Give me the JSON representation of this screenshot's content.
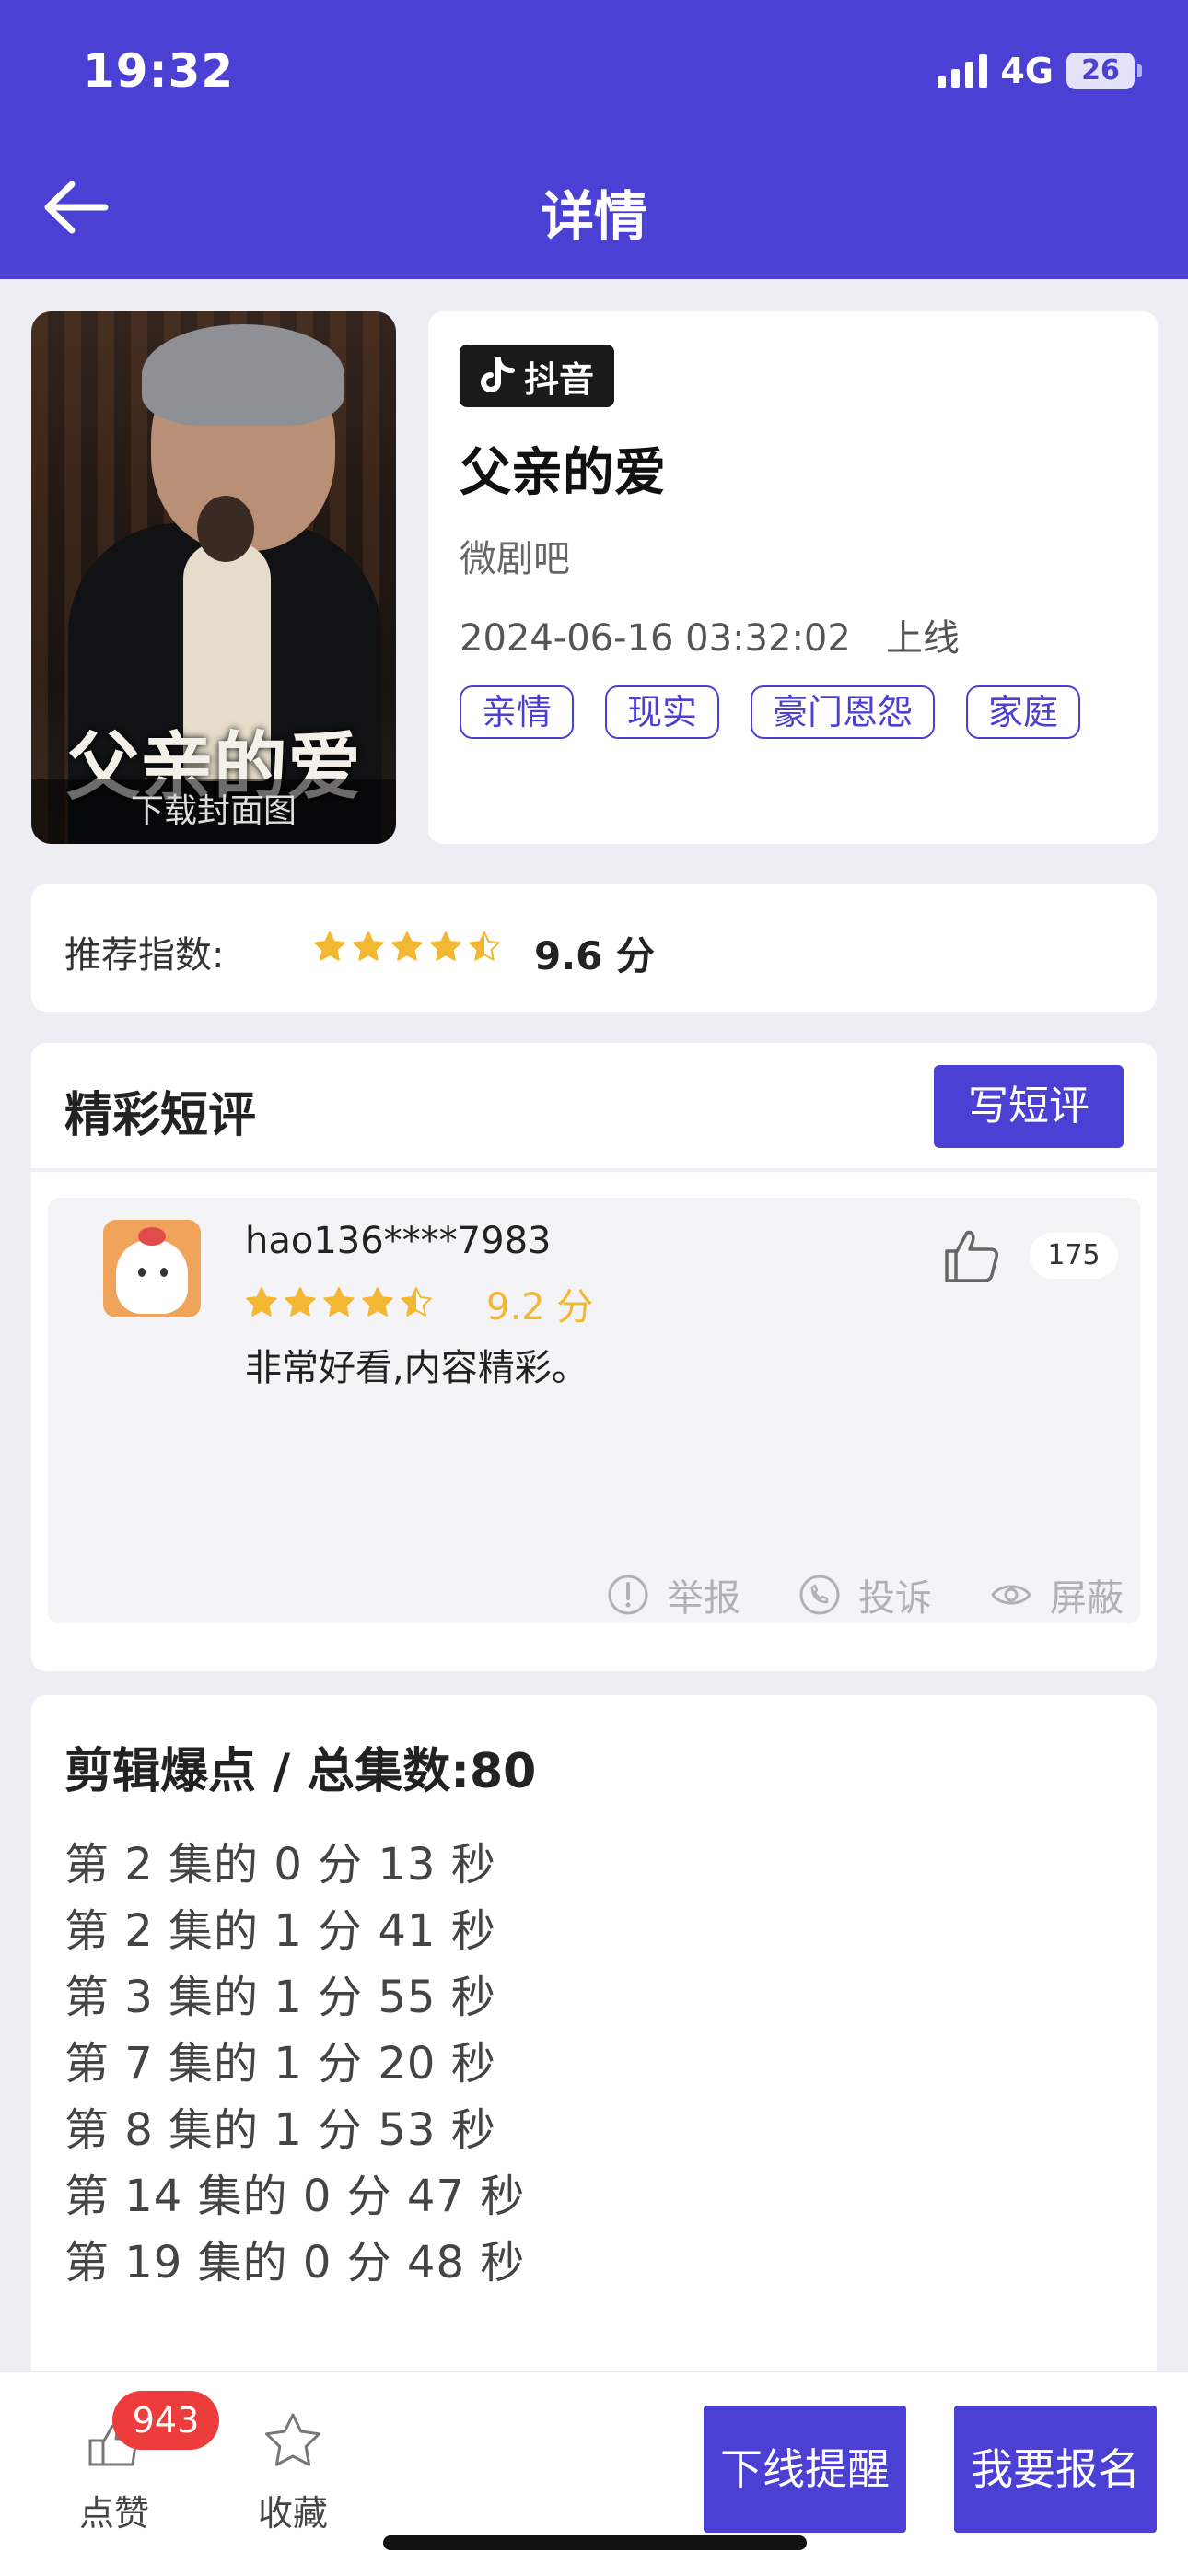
{
  "status_bar": {
    "time": "19:32",
    "network": "4G",
    "battery": "26"
  },
  "header": {
    "title": "详情",
    "back_icon": "arrow-left-icon"
  },
  "poster": {
    "title_art": "父亲的爱",
    "download_label": "下载封面图"
  },
  "info": {
    "platform": "抖音",
    "title": "父亲的爱",
    "studio": "微剧吧",
    "release_datetime": "2024-06-16 03:32:02",
    "release_status": "上线",
    "tags": [
      "亲情",
      "现实",
      "豪门恩怨",
      "家庭"
    ]
  },
  "rating": {
    "label": "推荐指数:",
    "stars": 4.5,
    "score": "9.6 分"
  },
  "reviews": {
    "title": "精彩短评",
    "write_label": "写短评",
    "items": [
      {
        "user": "hao136****7983",
        "stars": 4.5,
        "score": "9.2 分",
        "text": "非常好看,内容精彩。",
        "likes": "175",
        "actions": [
          "举报",
          "投诉",
          "屏蔽"
        ]
      }
    ]
  },
  "highlights": {
    "title": "剪辑爆点 / 总集数:80",
    "items": [
      "第 2 集的 0 分 13 秒",
      "第 2 集的 1 分 41 秒",
      "第 3 集的 1 分 55 秒",
      "第 7 集的 1 分 20 秒",
      "第 8 集的 1 分 53 秒",
      "第 14 集的 0 分 47 秒",
      "第 19 集的 0 分 48 秒"
    ]
  },
  "bottom_bar": {
    "like_label": "点赞",
    "like_badge": "943",
    "favorite_label": "收藏",
    "offline_reminder_label": "下线提醒",
    "signup_label": "我要报名"
  },
  "colors": {
    "primary": "#4c3fd4",
    "star": "#f4b731",
    "badge": "#ec3c3c",
    "background": "#edeef4"
  }
}
